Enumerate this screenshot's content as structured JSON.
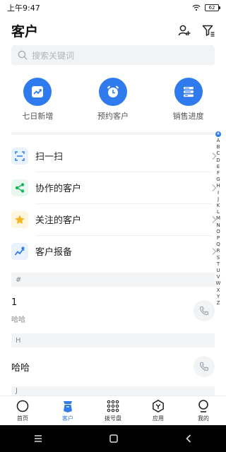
{
  "status_bar": {
    "time": "上午9:47",
    "battery": "62"
  },
  "header": {
    "title": "客户"
  },
  "search": {
    "placeholder": "搜索关键词"
  },
  "quick_actions": [
    {
      "label": "七日新增",
      "icon": "trend-chart-icon"
    },
    {
      "label": "预约客户",
      "icon": "alarm-clock-icon"
    },
    {
      "label": "销售进度",
      "icon": "progress-list-icon"
    }
  ],
  "menu": [
    {
      "label": "扫一扫",
      "icon": "scan-icon"
    },
    {
      "label": "协作的客户",
      "icon": "share-icon"
    },
    {
      "label": "关注的客户",
      "icon": "star-icon"
    },
    {
      "label": "客户报备",
      "icon": "report-icon"
    }
  ],
  "sections": [
    {
      "header": "#",
      "contacts": [
        {
          "name": "1",
          "subtitle": "哈哈"
        }
      ]
    },
    {
      "header": "H",
      "contacts": [
        {
          "name": "哈哈",
          "subtitle": ""
        }
      ]
    },
    {
      "header": "J"
    }
  ],
  "index_letters": [
    "#",
    "A",
    "B",
    "C",
    "D",
    "E",
    "F",
    "G",
    "H",
    "I",
    "J",
    "K",
    "L",
    "M",
    "N",
    "O",
    "P",
    "Q",
    "R",
    "S",
    "T",
    "U",
    "V",
    "W",
    "X",
    "Y",
    "Z"
  ],
  "tabbar": [
    {
      "label": "首页",
      "icon": "home-icon",
      "active": false
    },
    {
      "label": "客户",
      "icon": "customer-icon",
      "active": true
    },
    {
      "label": "拨号盘",
      "icon": "dialpad-icon",
      "active": false
    },
    {
      "label": "应用",
      "icon": "apps-icon",
      "active": false
    },
    {
      "label": "我的",
      "icon": "profile-icon",
      "active": false
    }
  ],
  "colors": {
    "accent": "#2f7bee",
    "background": "#ffffff",
    "section_bg": "#f3f4f6"
  }
}
